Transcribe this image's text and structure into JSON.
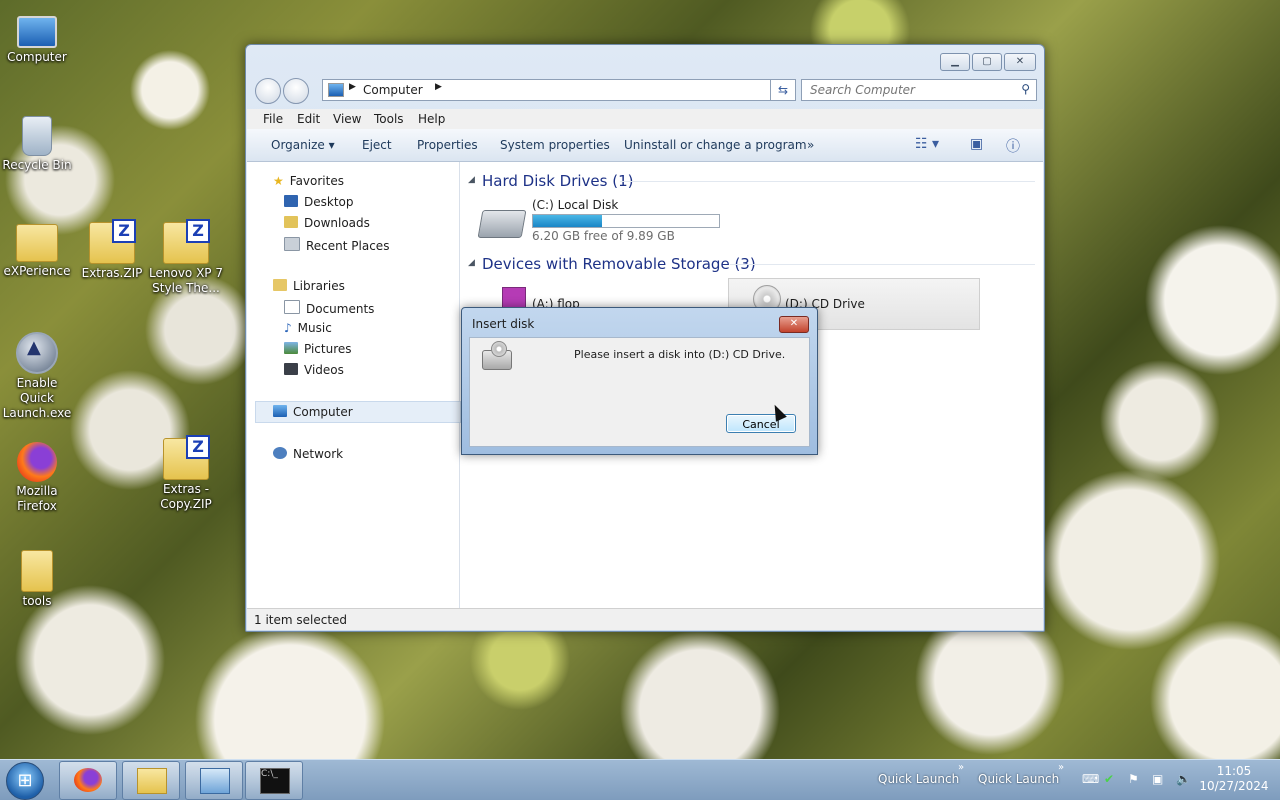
{
  "desktop": {
    "icons": [
      {
        "label": "Computer"
      },
      {
        "label": "Recycle Bin"
      },
      {
        "label": "eXPerience"
      },
      {
        "label": "Extras.ZIP"
      },
      {
        "label": "Lenovo XP 7 Style The..."
      },
      {
        "label": "Enable Quick Launch.exe"
      },
      {
        "label": "Mozilla Firefox"
      },
      {
        "label": "Extras - Copy.ZIP"
      },
      {
        "label": "tools"
      }
    ]
  },
  "explorer": {
    "address": {
      "crumb": "Computer"
    },
    "search": {
      "placeholder": "Search Computer"
    },
    "menu": [
      "File",
      "Edit",
      "View",
      "Tools",
      "Help"
    ],
    "commands": {
      "organize": "Organize",
      "eject": "Eject",
      "properties": "Properties",
      "system_properties": "System properties",
      "uninstall": "Uninstall or change a program",
      "more": "»"
    },
    "nav": {
      "favorites": "Favorites",
      "desktop": "Desktop",
      "downloads": "Downloads",
      "recent": "Recent Places",
      "libraries": "Libraries",
      "documents": "Documents",
      "music": "Music",
      "pictures": "Pictures",
      "videos": "Videos",
      "computer": "Computer",
      "network": "Network"
    },
    "groups": {
      "hdd_title": "Hard Disk Drives (1)",
      "removable_title": "Devices with Removable Storage (3)"
    },
    "drives": {
      "c_name": "(C:) Local Disk",
      "c_free": "6.20 GB free of 9.89 GB",
      "c_used_fraction": 0.373,
      "a_name": "(A:) flop",
      "d_name": "(D:) CD Drive"
    },
    "status": "1 item selected"
  },
  "dialog": {
    "title": "Insert disk",
    "message": "Please insert a disk into (D:) CD Drive.",
    "cancel": "Cancel"
  },
  "taskbar": {
    "quick_launch_1": "Quick Launch",
    "quick_launch_2": "Quick Launch",
    "time": "11:05",
    "date": "10/27/2024"
  }
}
